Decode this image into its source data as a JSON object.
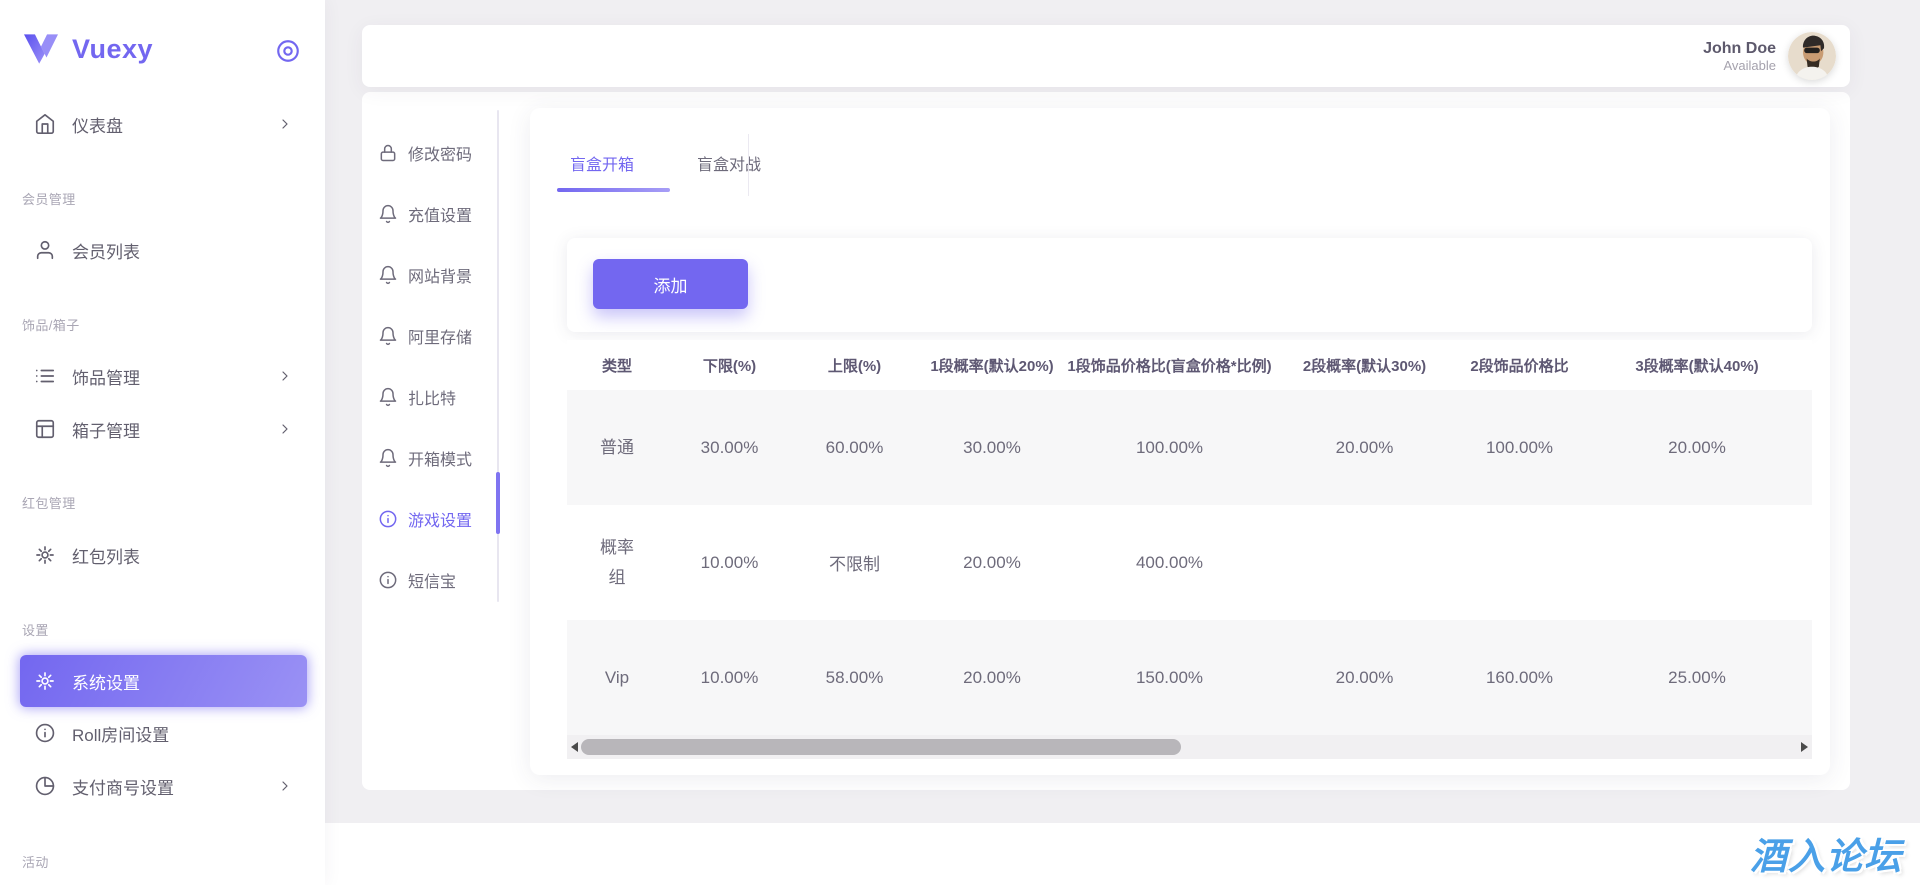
{
  "colors": {
    "primary": "#7367f0",
    "watermark_blue": "#4aa0e8",
    "text_dark": "#5e5873",
    "text_muted": "#6e6b7b",
    "row_stripe": "#f7f7f8"
  },
  "brand": {
    "name": "Vuexy"
  },
  "header": {
    "user_name": "John Doe",
    "user_status": "Available"
  },
  "sidebar": {
    "sections": [
      {
        "label": "",
        "items": [
          {
            "label": "仪表盘",
            "icon": "home-icon",
            "chevron": true
          }
        ]
      },
      {
        "label": "会员管理",
        "items": [
          {
            "label": "会员列表",
            "icon": "user-icon",
            "chevron": false
          }
        ]
      },
      {
        "label": "饰品/箱子",
        "items": [
          {
            "label": "饰品管理",
            "icon": "list-icon",
            "chevron": true
          },
          {
            "label": "箱子管理",
            "icon": "layout-icon",
            "chevron": true
          }
        ]
      },
      {
        "label": "红包管理",
        "items": [
          {
            "label": "红包列表",
            "icon": "gear-icon",
            "chevron": false
          }
        ]
      },
      {
        "label": "设置",
        "items": [
          {
            "label": "系统设置",
            "icon": "gear-icon",
            "chevron": false,
            "active": true
          },
          {
            "label": "Roll房间设置",
            "icon": "info-icon",
            "chevron": false
          },
          {
            "label": "支付商号设置",
            "icon": "pie-chart-icon",
            "chevron": true
          }
        ]
      },
      {
        "label": "活动",
        "items": []
      }
    ]
  },
  "settings_menu": {
    "items": [
      {
        "label": "修改密码",
        "icon": "lock-icon",
        "active": false
      },
      {
        "label": "充值设置",
        "icon": "bell-icon",
        "active": false
      },
      {
        "label": "网站背景",
        "icon": "bell-icon",
        "active": false
      },
      {
        "label": "阿里存储",
        "icon": "bell-icon",
        "active": false
      },
      {
        "label": "扎比特",
        "icon": "bell-icon",
        "active": false
      },
      {
        "label": "开箱模式",
        "icon": "bell-icon",
        "active": false
      },
      {
        "label": "游戏设置",
        "icon": "info-icon",
        "active": true
      },
      {
        "label": "短信宝",
        "icon": "info-icon",
        "active": false
      }
    ]
  },
  "tabs": [
    {
      "label": "盲盒开箱",
      "active": true
    },
    {
      "label": "盲盒对战",
      "active": false
    }
  ],
  "toolbar": {
    "add_label": "添加"
  },
  "table": {
    "columns": [
      "类型",
      "下限(%)",
      "上限(%)",
      "1段概率(默认20%)",
      "1段饰品价格比(盲盒价格*比例)",
      "2段概率(默认30%)",
      "2段饰品价格比",
      "3段概率(默认40%)"
    ],
    "rows": [
      [
        "普通",
        "30.00%",
        "60.00%",
        "30.00%",
        "100.00%",
        "20.00%",
        "100.00%",
        "20.00%"
      ],
      [
        "概率组",
        "10.00%",
        "不限制",
        "20.00%",
        "400.00%",
        "",
        "",
        ""
      ],
      [
        "Vip",
        "10.00%",
        "58.00%",
        "20.00%",
        "150.00%",
        "20.00%",
        "160.00%",
        "25.00%"
      ]
    ]
  },
  "watermark": {
    "text": "酒入论坛"
  }
}
